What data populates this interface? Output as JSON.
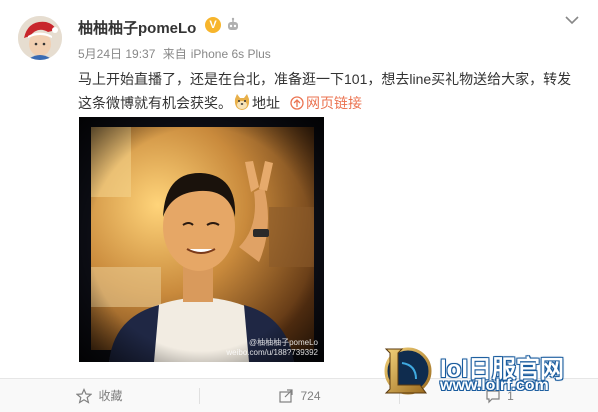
{
  "post": {
    "username": "柚柚柚子pomeLo",
    "vip_badge": "V",
    "date": "5月24日 19:37",
    "source_prefix": "来自",
    "source": "iPhone 6s Plus",
    "text_line1": "马上开始直播了，还是在台北，准备逛一下101，想去line买礼物送给大家，转发",
    "text_line2": "这条微博就有机会获奖。",
    "location": "地址",
    "web_link": "网页链接",
    "watermark_line1": "@柚柚柚子pomeLo",
    "watermark_line2": "weibo.com/u/188?739392",
    "icons": [
      "robot-icon",
      "chevron-down-icon",
      "doge-emoji-icon",
      "link-icon",
      "star-icon",
      "share-icon",
      "comment-icon"
    ]
  },
  "toolbar": {
    "favorite_label": "收藏",
    "repost_count": "724",
    "comment_count": "1"
  },
  "site_banner": {
    "name": "lol日服官网",
    "url": "www.lolrf.com"
  },
  "colors": {
    "link": "#eb7350",
    "meta": "#888888",
    "vip": "#f7b52c"
  }
}
